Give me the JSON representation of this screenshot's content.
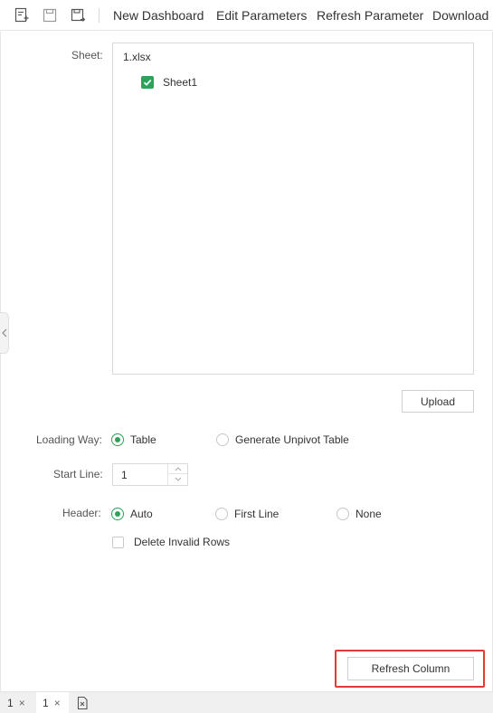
{
  "toolbar": {
    "icons": [
      "new-template-icon",
      "save-icon",
      "save-as-icon"
    ],
    "items": {
      "new_dashboard": "New Dashboard",
      "edit_parameters": "Edit Parameters",
      "refresh_parameter": "Refresh Parameter",
      "download": "Download"
    }
  },
  "form": {
    "sheet_label": "Sheet:",
    "file_name": "1.xlsx",
    "sheets": [
      {
        "name": "Sheet1",
        "checked": true
      }
    ],
    "upload_label": "Upload",
    "loading_way_label": "Loading Way:",
    "loading_way_options": [
      "Table",
      "Generate Unpivot Table"
    ],
    "loading_way_selected": "Table",
    "start_line_label": "Start Line:",
    "start_line_value": "1",
    "header_label": "Header:",
    "header_options": [
      "Auto",
      "First Line",
      "None"
    ],
    "header_selected": "Auto",
    "delete_invalid_rows_label": "Delete Invalid Rows",
    "delete_invalid_rows_checked": false,
    "refresh_column_label": "Refresh Column"
  },
  "tabs": [
    {
      "label": "1",
      "close": "×",
      "active": false
    },
    {
      "label": "1",
      "close": "×",
      "active": true
    }
  ],
  "colors": {
    "accent_green": "#2ea15a",
    "highlight_red": "#e53935"
  }
}
